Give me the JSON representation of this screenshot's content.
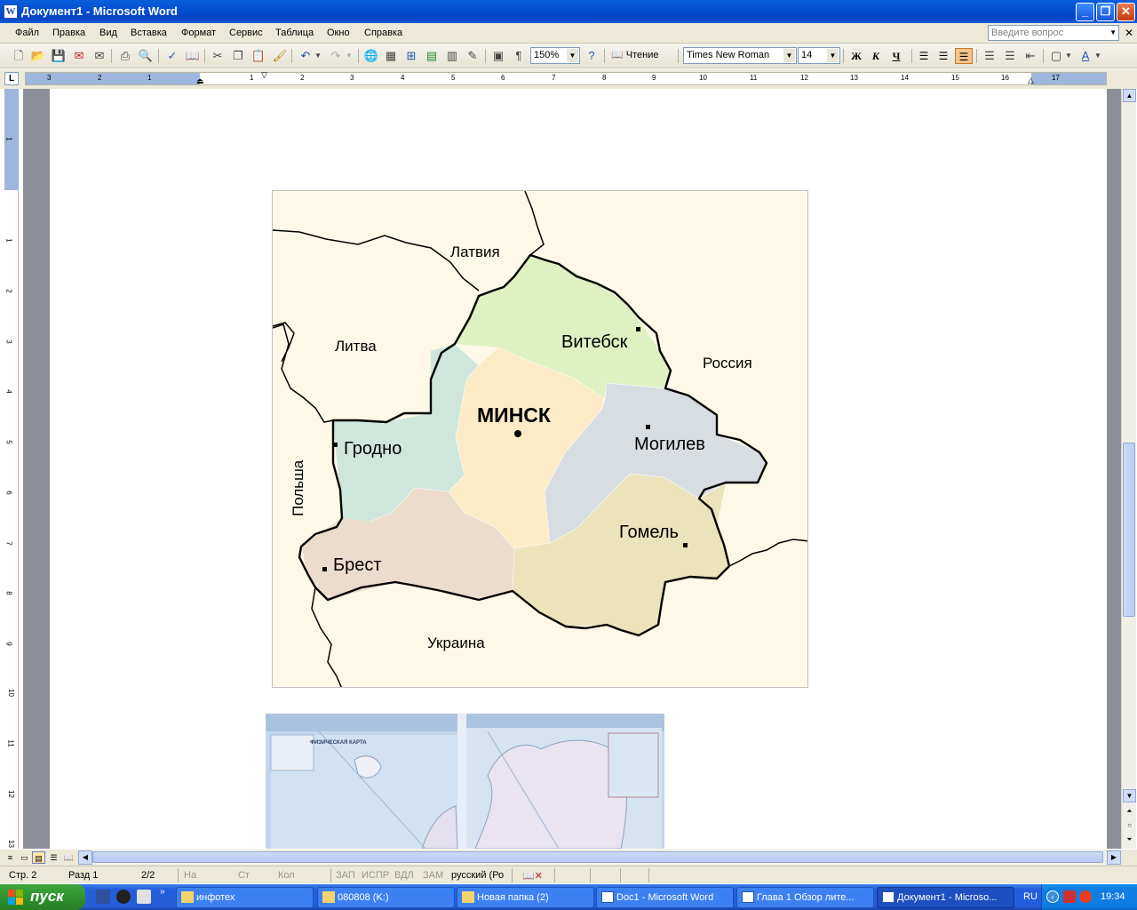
{
  "window": {
    "title": "Документ1 - Microsoft Word"
  },
  "menu": {
    "items": [
      "Файл",
      "Правка",
      "Вид",
      "Вставка",
      "Формат",
      "Сервис",
      "Таблица",
      "Окно",
      "Справка"
    ],
    "ask_placeholder": "Введите вопрос"
  },
  "toolbar": {
    "zoom": "150%",
    "reading_label": "Чтение",
    "font_name": "Times New Roman",
    "font_size": "14",
    "bold": "Ж",
    "italic": "К",
    "underline": "Ч"
  },
  "ruler": {
    "tab_selector": "L",
    "h_numbers": [
      "3",
      "2",
      "1",
      "1",
      "2",
      "3",
      "4",
      "5",
      "6",
      "7",
      "8",
      "9",
      "10",
      "11",
      "12",
      "13",
      "14",
      "15",
      "16",
      "17"
    ],
    "v_numbers": [
      "1",
      "1",
      "2",
      "3",
      "4",
      "5",
      "6",
      "7",
      "8",
      "9",
      "10",
      "11",
      "12",
      "13"
    ]
  },
  "map": {
    "countries": {
      "latvia": "Латвия",
      "lithuania": "Литва",
      "russia": "Россия",
      "poland": "Польша",
      "ukraine": "Украина"
    },
    "cities": {
      "minsk": "МИНСК",
      "vitebsk": "Витебск",
      "grodno": "Гродно",
      "mogilev": "Могилев",
      "brest": "Брест",
      "gomel": "Гомель"
    },
    "region_colors": {
      "vitebsk": "#dff0c3",
      "grodno": "#cfe6dc",
      "minsk": "#fcebc6",
      "mogilev": "#d8dde2",
      "brest": "#ecdccb",
      "gomel": "#eae3bb"
    }
  },
  "scan": {
    "title": "ФИЗИЧЕСКАЯ КАРТА"
  },
  "status": {
    "page": "Стр. 2",
    "section": "Разд 1",
    "pages": "2/2",
    "at": "На",
    "line": "Ст",
    "col": "Кол",
    "rec": "ЗАП",
    "trk": "ИСПР",
    "ext": "ВДЛ",
    "ovr": "ЗАМ",
    "lang": "русский (Ро"
  },
  "taskbar": {
    "start": "пуск",
    "tasks": [
      "инфотех",
      "080808 (K:)",
      "Новая папка (2)",
      "Doc1 - Microsoft Word",
      "Глава 1 Обзор лите...",
      "Документ1 - Microso..."
    ],
    "lang": "RU",
    "time": "19:34"
  }
}
